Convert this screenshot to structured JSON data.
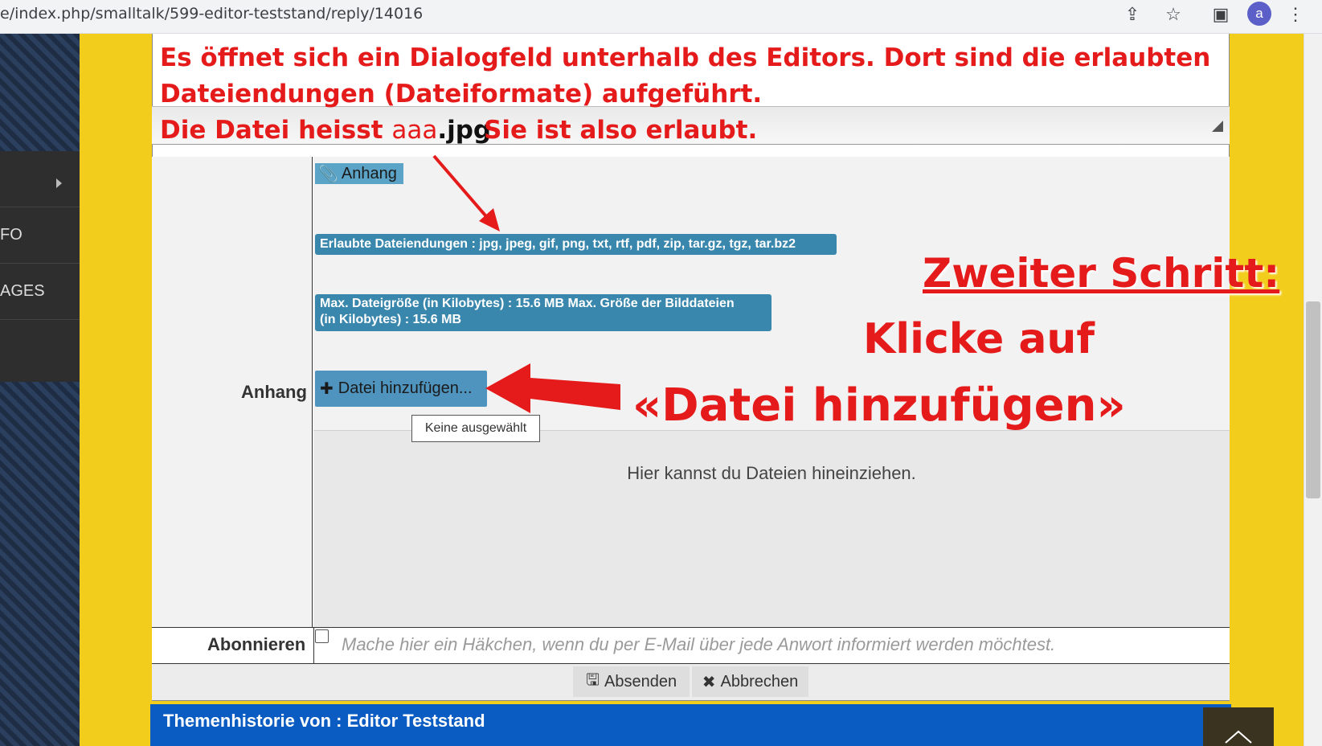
{
  "browser": {
    "url": "e/index.php/smalltalk/599-editor-teststand/reply/14016",
    "avatar_letter": "a"
  },
  "sidebar": {
    "items": [
      {
        "label": ""
      },
      {
        "label": "FO"
      },
      {
        "label": "AGES"
      }
    ]
  },
  "annotations": {
    "line1": "Es öffnet sich ein Dialogfeld unterhalb des Editors. Dort sind die erlaubten",
    "line2": "Dateiendungen (Dateiformate) aufgeführt.",
    "line3_prefix": "Die Datei heisst ",
    "line3_name": "aaa",
    "line3_ext": ".jpg",
    "line3_suffix": "Sie ist also erlaubt.",
    "step_title": "Zweiter Schritt:",
    "step_line1": "Klicke auf",
    "step_line2": "«Datei hinzufügen»"
  },
  "attachment": {
    "button_label": "Anhang",
    "allowed_extensions": "Erlaubte Dateiendungen : jpg, jpeg, gif, png, txt, rtf, pdf, zip, tar.gz, tgz, tar.bz2",
    "max_size_line1": "Max. Dateigröße (in Kilobytes) : 15.6 MB Max. Größe der Bilddateien",
    "max_size_line2": "(in Kilobytes) : 15.6 MB",
    "add_file_label": "Datei hinzufügen...",
    "tooltip": "Keine ausgewählt",
    "dropzone_text": "Hier kannst du Dateien hineinziehen.",
    "field_label": "Anhang"
  },
  "subscribe": {
    "label": "Abonnieren",
    "hint": "Mache hier ein Häkchen, wenn du per E-Mail über jede Anwort informiert werden möchtest."
  },
  "actions": {
    "submit": "Absenden",
    "cancel": "Abbrechen"
  },
  "footer": {
    "title": "Themenhistorie von : Editor Teststand"
  },
  "colors": {
    "annotation_red": "#e51b1b",
    "badge_blue": "#3a87ad",
    "footer_blue": "#0a5cc2",
    "page_yellow": "#f2cd1c"
  }
}
